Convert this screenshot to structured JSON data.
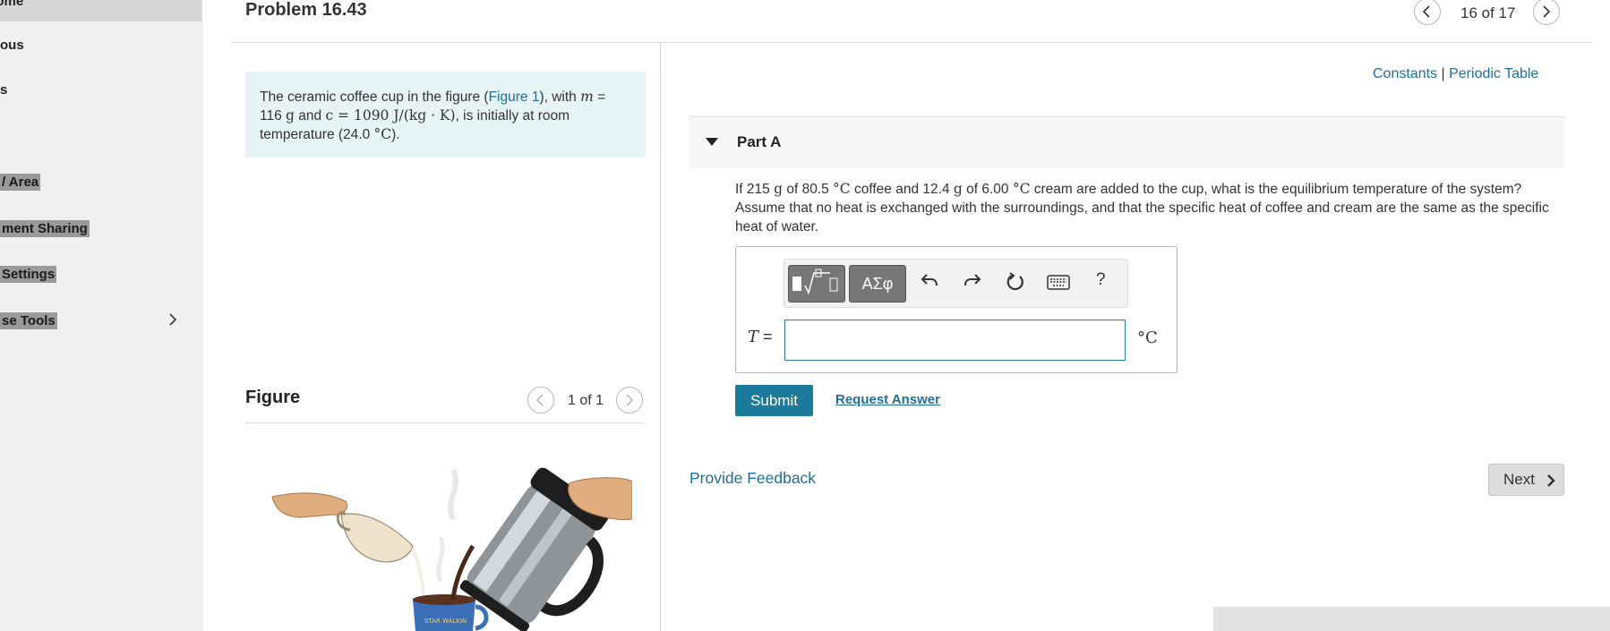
{
  "sidebar": {
    "items": [
      {
        "label": "e Home"
      },
      {
        "label": "ous"
      },
      {
        "label": "s"
      },
      {
        "label": "/ Area"
      },
      {
        "label": "ment Sharing"
      },
      {
        "label": "Settings"
      },
      {
        "label": "se Tools"
      }
    ],
    "chevron_icon": "chevron-right-icon"
  },
  "header": {
    "title": "Problem 16.43",
    "pager": "16 of 17",
    "prev_icon": "chevron-left-icon",
    "next_icon": "chevron-right-icon"
  },
  "problem": {
    "text_1": "The ceramic coffee cup in the figure (",
    "figure_link": "Figure 1",
    "text_2": "), with ",
    "m_var": "m",
    "text_3": " =",
    "m_value": "116",
    "m_unit": "g",
    "text_4": " and ",
    "c_expr": "c = 1090 J/(kg · K)",
    "text_5": ", is initially at room temperature (24.0 ",
    "temp_unit": "°C",
    "text_6": ")."
  },
  "figure": {
    "title": "Figure",
    "pager": "1 of 1",
    "mug_text": "STAR WALKIN"
  },
  "links": {
    "constants": "Constants",
    "separator": "|",
    "periodic_table": "Periodic Table"
  },
  "part_a": {
    "title": "Part A",
    "question": {
      "q1": "If 215 ",
      "g1": "g",
      "q2": " of 80.5 ",
      "u1": "°C",
      "q3": " coffee and 12.4 ",
      "g2": "g",
      "q4": " of 6.00 ",
      "u2": "°C",
      "q5": " cream are added to the cup, what is the equilibrium temperature of the system? Assume that no heat is exchanged with the surroundings, and that the specific heat of coffee and cream are the same as the specific heat of water."
    },
    "answer": {
      "variable": "T",
      "equals": "=",
      "value": "",
      "unit": "°C"
    },
    "toolbar": {
      "symbols_label": "ΑΣφ",
      "help": "?"
    },
    "submit_label": "Submit",
    "request_answer_label": "Request Answer"
  },
  "footer": {
    "feedback_label": "Provide Feedback",
    "next_label": "Next"
  }
}
